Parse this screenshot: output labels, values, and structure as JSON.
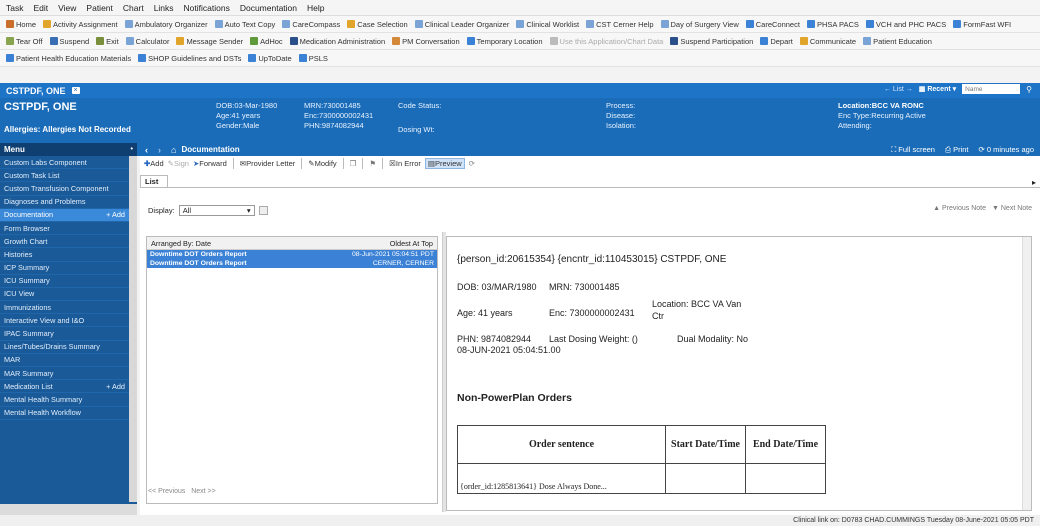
{
  "menubar": [
    "Task",
    "Edit",
    "View",
    "Patient",
    "Chart",
    "Links",
    "Notifications",
    "Documentation",
    "Help"
  ],
  "toolbar1": [
    {
      "label": "Home",
      "color": "#c96f2b"
    },
    {
      "label": "Activity Assignment",
      "color": "#e0a52a"
    },
    {
      "label": "Ambulatory Organizer",
      "color": "#7aa4d6"
    },
    {
      "label": "Auto Text Copy",
      "color": "#7aa4d6"
    },
    {
      "label": "CareCompass",
      "color": "#7aa4d6"
    },
    {
      "label": "Case Selection",
      "color": "#e0a52a"
    },
    {
      "label": "Clinical Leader Organizer",
      "color": "#7aa4d6"
    },
    {
      "label": "Clinical Worklist",
      "color": "#7aa4d6"
    },
    {
      "label": "CST Cerner Help",
      "color": "#7aa4d6"
    },
    {
      "label": "Day of Surgery View",
      "color": "#7aa4d6"
    },
    {
      "label": "CareConnect",
      "color": "#3b82d6"
    },
    {
      "label": "PHSA PACS",
      "color": "#3b82d6"
    },
    {
      "label": "VCH and PHC PACS",
      "color": "#3b82d6"
    },
    {
      "label": "FormFast WFI",
      "color": "#3b82d6"
    }
  ],
  "toolbar2": [
    {
      "label": "Tear Off",
      "color": "#8aa34e"
    },
    {
      "label": "Suspend",
      "color": "#3b6fb5"
    },
    {
      "label": "Exit",
      "color": "#7a8e3b"
    },
    {
      "label": "Calculator",
      "color": "#7aa4d6"
    },
    {
      "label": "Message Sender",
      "color": "#e0a52a"
    },
    {
      "label": "AdHoc",
      "color": "#5f9a3b"
    },
    {
      "label": "Medication Administration",
      "color": "#2b4f8a"
    },
    {
      "label": "PM Conversation",
      "color": "#d4883a"
    },
    {
      "label": "Temporary Location",
      "color": "#3b82d6"
    },
    {
      "label": "Use this Application/Chart Data",
      "color": "#bbbbbb",
      "faded": true
    },
    {
      "label": "Suspend Participation",
      "color": "#2b4f8a"
    },
    {
      "label": "Depart",
      "color": "#3b82d6"
    },
    {
      "label": "Communicate",
      "color": "#e0a52a"
    },
    {
      "label": "Patient Education",
      "color": "#7aa4d6"
    }
  ],
  "toolbar3": [
    {
      "label": "Patient Health Education Materials",
      "color": "#3b82d6"
    },
    {
      "label": "SHOP Guidelines and DSTs",
      "color": "#3b82d6"
    },
    {
      "label": "UpToDate",
      "color": "#3b82d6"
    },
    {
      "label": "PSLS",
      "color": "#3b82d6"
    }
  ],
  "banner": {
    "tab_name": "CSTPDF, ONE",
    "patient_name": "CSTPDF, ONE",
    "allergies": "Allergies: Allergies Not Recorded",
    "dob": "DOB:03-Mar-1980",
    "age": "Age:41 years",
    "gender": "Gender:Male",
    "mrn": "MRN:730001485",
    "enc": "Enc:7300000002431",
    "phn": "PHN:9874082944",
    "code_status": "Code Status:",
    "dosing_wt": "Dosing Wt:",
    "process": "Process:",
    "disease": "Disease:",
    "isolation": "Isolation:",
    "location": "Location:BCC VA RONC",
    "enc_type": "Enc Type:Recurring Active",
    "attending": "Attending:",
    "list_label": "List",
    "recent_label": "Recent",
    "name_placeholder": "Name"
  },
  "nav": {
    "title": "Menu",
    "items": [
      {
        "label": "Custom Labs Component"
      },
      {
        "label": "Custom Task List"
      },
      {
        "label": "Custom Transfusion Component"
      },
      {
        "label": "Diagnoses and Problems"
      },
      {
        "label": "Documentation",
        "active": true,
        "add": "+ Add"
      },
      {
        "label": "Form Browser"
      },
      {
        "label": "Growth Chart"
      },
      {
        "label": "Histories"
      },
      {
        "label": "ICP Summary"
      },
      {
        "label": "ICU Summary"
      },
      {
        "label": "ICU View"
      },
      {
        "label": "Immunizations"
      },
      {
        "label": "Interactive View and I&O"
      },
      {
        "label": "IPAC Summary"
      },
      {
        "label": "Lines/Tubes/Drains Summary"
      },
      {
        "label": "MAR"
      },
      {
        "label": "MAR Summary"
      },
      {
        "label": "Medication List",
        "add": "+ Add"
      },
      {
        "label": "Mental Health Summary"
      },
      {
        "label": "Mental Health Workflow"
      }
    ]
  },
  "subbar": {
    "title": "Documentation",
    "fullscreen": "Full screen",
    "print": "Print",
    "timer": "0 minutes ago"
  },
  "doc_toolbar": {
    "add": "Add",
    "sign": "Sign",
    "forward": "Forward",
    "provider_letter": "Provider Letter",
    "modify": "Modify",
    "in_error": "In Error",
    "preview": "Preview"
  },
  "tab": "List",
  "display": {
    "label": "Display:",
    "value": "All"
  },
  "note_nav": {
    "previous": "Previous Note",
    "next": "Next Note"
  },
  "list": {
    "col_left": "Arranged By: Date",
    "col_right": "Oldest At Top",
    "rows": [
      {
        "title": "Downtime DOT Orders Report",
        "detail": "08-Jun-2021 05:04:51 PDT"
      },
      {
        "title": "Downtime DOT Orders Report",
        "detail": "CERNER, CERNER"
      }
    ],
    "pager_prev": "<< Previous",
    "pager_next": "Next >>"
  },
  "doc": {
    "header_line": "{person_id:20615354} {encntr_id:110453015} CSTPDF, ONE",
    "dob": "DOB: 03/MAR/1980",
    "mrn": "MRN: 730001485",
    "age": "Age: 41 years",
    "enc": "Enc: 7300000002431",
    "location_1": "Location: BCC VA Van",
    "location_2": "Ctr",
    "phn": "PHN: 9874082944",
    "dosing": "Last Dosing Weight: ()",
    "modality": "Dual Modality: No",
    "timestamp": "08-JUN-2021 05:04:51.00",
    "section_title": "Non-PowerPlan Orders",
    "table_headers": [
      "Order sentence",
      "Start Date/Time",
      "End Date/Time"
    ],
    "table_row_partial": "{order_id:1285813641} Dose Always Done..."
  },
  "status": "Clinical link on: D0783 CHAD.CUMMINGS Tuesday 08-June-2021 05:05 PDT"
}
